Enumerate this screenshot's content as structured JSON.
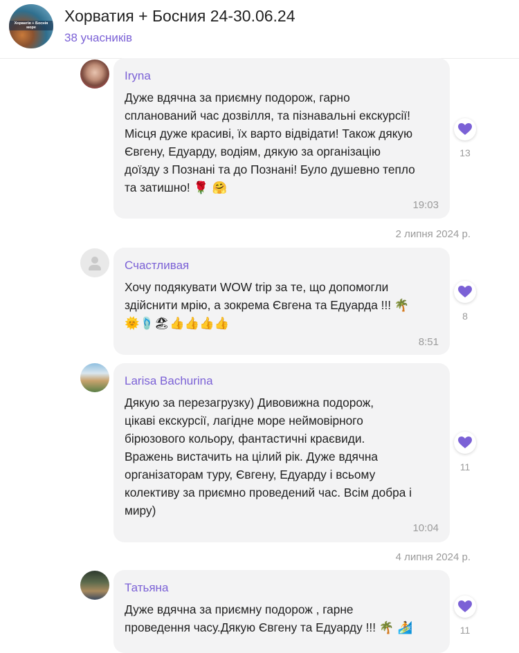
{
  "header": {
    "title": "Хорватия + Босния 24-30.06.24",
    "members": "38 учасників",
    "avatar_text": "Хорватія + Боснія море"
  },
  "accent_color": "#7b61d6",
  "messages": [
    {
      "author": "Iryna",
      "text_lines": [
        "Дуже вдячна за приємну подорож, гарно",
        "спланований час дозвілля, та пізнавальні екскурсії!",
        "Місця дуже красиві, їх варто відвідати! Також дякую",
        "Євгену, Едуарду, водіям, дякую за організацію",
        "доїзду з Познані та до Познані! Було душевно тепло",
        "та затишно!"
      ],
      "emojis": "🌹 🤗",
      "time": "19:03",
      "reaction_icon": "heart-icon",
      "reaction_count": "13"
    },
    {
      "author": "Счастливая",
      "text_lines": [
        "Хочу подякувати  WOW trip за те, що допомогли",
        "здійснити мрію, а зокрема Євгена та  Едуарда !!!"
      ],
      "emojis_line1": "🌴",
      "emojis_line2": "🌞🩴🏖👍👍👍👍",
      "time": "8:51",
      "reaction_icon": "heart-icon",
      "reaction_count": "8"
    },
    {
      "author": "Larisa Bachurina",
      "text_lines": [
        "Дякую за перезагрузку) Дивовижна подорож,",
        "цікаві екскурсії, лагідне море неймовірного",
        "бірюзового кольору, фантастичні краєвиди.",
        "Вражень вистачить на цілий рік. Дуже вдячна",
        "організаторам туру, Євгену, Едуарду і всьому",
        "колективу за приємно проведений час. Всім добра і",
        "миру)"
      ],
      "time": "10:04",
      "reaction_icon": "heart-icon",
      "reaction_count": "11"
    },
    {
      "author": "Татьяна",
      "text_lines": [
        "Дуже вдячна за приємну подорож , гарне",
        "проведення часу.Дякую Євгену та Едуарду !!!"
      ],
      "emojis": "🌴 🏄",
      "reaction_icon": "heart-icon",
      "reaction_count": "11"
    }
  ],
  "date_separators": [
    "2 липня 2024 р.",
    "4 липня 2024 р."
  ]
}
